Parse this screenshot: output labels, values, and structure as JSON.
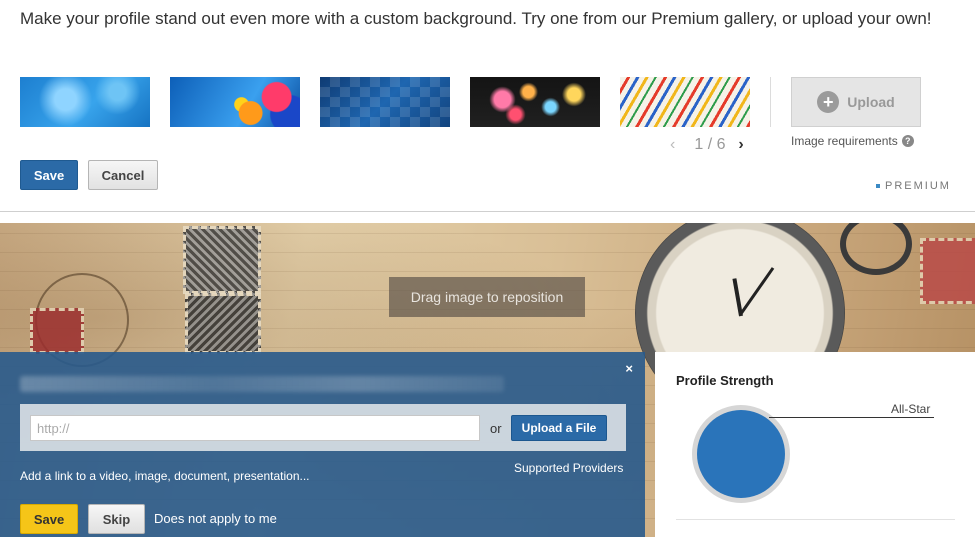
{
  "background_editor": {
    "intro_text": "Make your profile stand out even more with a custom background. Try one from our Premium gallery, or upload your own!",
    "upload_label": "Upload",
    "pager": {
      "prev": "‹",
      "text": "1 / 6",
      "next": "›"
    },
    "image_requirements": "Image requirements",
    "help_icon": "?",
    "save_label": "Save",
    "cancel_label": "Cancel",
    "premium_label": "PREMIUM"
  },
  "cover_image": {
    "drag_hint": "Drag image to reposition"
  },
  "media_panel": {
    "close_label": "×",
    "url_placeholder": "http://",
    "or_label": "or",
    "upload_file_label": "Upload a File",
    "add_link_text": "Add a link to a video, image, document, presentation...",
    "supported_providers": "Supported Providers",
    "save_label": "Save",
    "skip_label": "Skip",
    "not_apply_label": "Does not apply to me"
  },
  "profile_strength": {
    "title": "Profile Strength",
    "level_label": "All-Star"
  },
  "colors": {
    "primary_blue": "#2b6aa7",
    "save_yellow": "#f5c518",
    "strength_blue": "#2a74ba"
  }
}
